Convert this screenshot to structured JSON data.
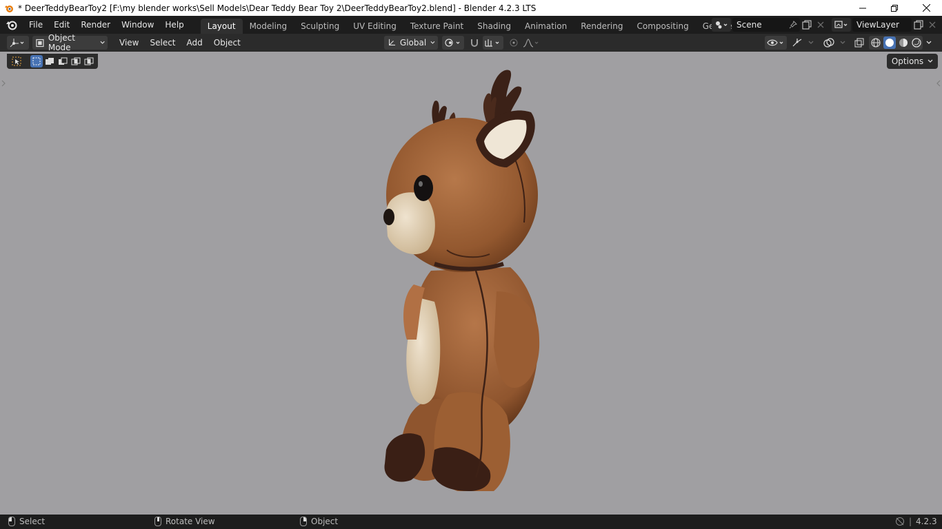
{
  "window": {
    "title": "* DeerTeddyBearToy2 [F:\\my blender works\\Sell Models\\Dear Teddy Bear Toy 2\\DeerTeddyBearToy2.blend] - Blender 4.2.3 LTS"
  },
  "menubar": {
    "items": [
      {
        "label": "File"
      },
      {
        "label": "Edit"
      },
      {
        "label": "Render"
      },
      {
        "label": "Window"
      },
      {
        "label": "Help"
      }
    ]
  },
  "workspaces": {
    "tabs": [
      {
        "label": "Layout",
        "active": true
      },
      {
        "label": "Modeling"
      },
      {
        "label": "Sculpting"
      },
      {
        "label": "UV Editing"
      },
      {
        "label": "Texture Paint"
      },
      {
        "label": "Shading"
      },
      {
        "label": "Animation"
      },
      {
        "label": "Rendering"
      },
      {
        "label": "Compositing"
      },
      {
        "label": "Geometry Nodes"
      }
    ]
  },
  "scene": {
    "name": "Scene"
  },
  "view_layer": {
    "name": "ViewLayer"
  },
  "viewport_header": {
    "mode": "Object Mode",
    "menus": [
      {
        "label": "View"
      },
      {
        "label": "Select"
      },
      {
        "label": "Add"
      },
      {
        "label": "Object"
      }
    ],
    "orientation": "Global"
  },
  "viewport": {
    "options_label": "Options"
  },
  "statusbar": {
    "select": "Select",
    "rotate": "Rotate View",
    "object": "Object",
    "version": "4.2.3"
  },
  "colors": {
    "accent": "#4772b3",
    "topbar": "#1d1d1d",
    "header": "#2b2b2b",
    "viewport_bg": "#a09fa2"
  }
}
